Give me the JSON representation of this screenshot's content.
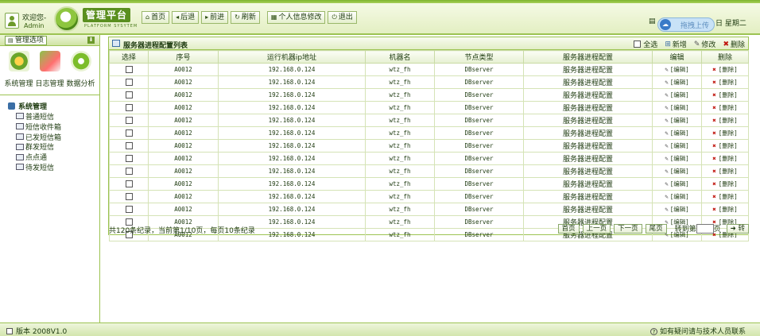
{
  "header": {
    "welcome": "欢迎您-",
    "username": "Admin",
    "logo_title": "管理平台",
    "logo_sub": "PLATFORM SYSYTEM",
    "nav": [
      {
        "icon": "home-icon",
        "glyph": "⌂",
        "label": "首页"
      },
      {
        "icon": "back-icon",
        "glyph": "◂",
        "label": "后退"
      },
      {
        "icon": "forward-icon",
        "glyph": "▸",
        "label": "前进"
      },
      {
        "icon": "refresh-icon",
        "glyph": "↻",
        "label": "刷新"
      },
      {
        "icon": "profile-icon",
        "glyph": "▦",
        "label": "个人信息修改"
      },
      {
        "icon": "logout-icon",
        "glyph": "⏻",
        "label": "退出"
      }
    ],
    "upload_label": "拖拽上传",
    "date_fragment": "日",
    "weekday": "星期二"
  },
  "sidebar": {
    "title": "管理选项",
    "modules": [
      {
        "label": "系统管理",
        "icon": "system-icon"
      },
      {
        "label": "日志管理",
        "icon": "log-icon"
      },
      {
        "label": "数据分析",
        "icon": "data-icon"
      }
    ],
    "tree_root": "系统管理",
    "tree_items": [
      "普通短信",
      "短信收件箱",
      "已发短信箱",
      "群发短信",
      "点点通",
      "待发短信"
    ]
  },
  "panel": {
    "title": "服务器进程配置列表",
    "tools": {
      "select_all": "全选",
      "add": "新增",
      "edit": "修改",
      "delete": "删除"
    },
    "columns": [
      "选择",
      "序号",
      "运行机器ip地址",
      "机器名",
      "节点类型",
      "服务器进程配置",
      "编辑",
      "删除"
    ],
    "rows": [
      {
        "id": "A0012",
        "ip": "192.168.0.124",
        "machine": "wtz_fh",
        "node_type": "DBserver",
        "config": "服务器进程配置",
        "edit": "[编辑]",
        "delete": "[删除]"
      },
      {
        "id": "A0012",
        "ip": "192.168.0.124",
        "machine": "wtz_fh",
        "node_type": "DBserver",
        "config": "服务器进程配置",
        "edit": "[编辑]",
        "delete": "[删除]"
      },
      {
        "id": "A0012",
        "ip": "192.168.0.124",
        "machine": "wtz_fh",
        "node_type": "DBserver",
        "config": "服务器进程配置",
        "edit": "[编辑]",
        "delete": "[删除]"
      },
      {
        "id": "A0012",
        "ip": "192.168.0.124",
        "machine": "wtz_fh",
        "node_type": "DBserver",
        "config": "服务器进程配置",
        "edit": "[编辑]",
        "delete": "[删除]"
      },
      {
        "id": "A0012",
        "ip": "192.168.0.124",
        "machine": "wtz_fh",
        "node_type": "DBserver",
        "config": "服务器进程配置",
        "edit": "[编辑]",
        "delete": "[删除]"
      },
      {
        "id": "A0012",
        "ip": "192.168.0.124",
        "machine": "wtz_fh",
        "node_type": "DBserver",
        "config": "服务器进程配置",
        "edit": "[编辑]",
        "delete": "[删除]"
      },
      {
        "id": "A0012",
        "ip": "192.168.0.124",
        "machine": "wtz_fh",
        "node_type": "DBserver",
        "config": "服务器进程配置",
        "edit": "[编辑]",
        "delete": "[删除]"
      },
      {
        "id": "A0012",
        "ip": "192.168.0.124",
        "machine": "wtz_fh",
        "node_type": "DBserver",
        "config": "服务器进程配置",
        "edit": "[编辑]",
        "delete": "[删除]"
      },
      {
        "id": "A0012",
        "ip": "192.168.0.124",
        "machine": "wtz_fh",
        "node_type": "DBserver",
        "config": "服务器进程配置",
        "edit": "[编辑]",
        "delete": "[删除]"
      },
      {
        "id": "A0012",
        "ip": "192.168.0.124",
        "machine": "wtz_fh",
        "node_type": "DBserver",
        "config": "服务器进程配置",
        "edit": "[编辑]",
        "delete": "[删除]"
      },
      {
        "id": "A0012",
        "ip": "192.168.0.124",
        "machine": "wtz_fh",
        "node_type": "DBserver",
        "config": "服务器进程配置",
        "edit": "[编辑]",
        "delete": "[删除]"
      },
      {
        "id": "A0012",
        "ip": "192.168.0.124",
        "machine": "wtz_fh",
        "node_type": "DBserver",
        "config": "服务器进程配置",
        "edit": "[编辑]",
        "delete": "[删除]"
      },
      {
        "id": "A0012",
        "ip": "192.168.0.124",
        "machine": "wtz_fh",
        "node_type": "DBserver",
        "config": "服务器进程配置",
        "edit": "[编辑]",
        "delete": "[删除]"
      },
      {
        "id": "A0012",
        "ip": "192.168.0.124",
        "machine": "wtz_fh",
        "node_type": "DBserver",
        "config": "服务器进程配置",
        "edit": "[编辑]",
        "delete": "[删除]"
      }
    ]
  },
  "pager": {
    "summary": "共120条纪录，当前第1/10页，每页10条纪录",
    "first": "首页",
    "prev": "上一页",
    "next": "下一页",
    "last": "尾页",
    "jump_label": "转到第",
    "page_unit": "页",
    "go": "➜ 转"
  },
  "footer": {
    "version": "版本 2008V1.0",
    "contact": "如有疑问请与技术人员联系"
  }
}
